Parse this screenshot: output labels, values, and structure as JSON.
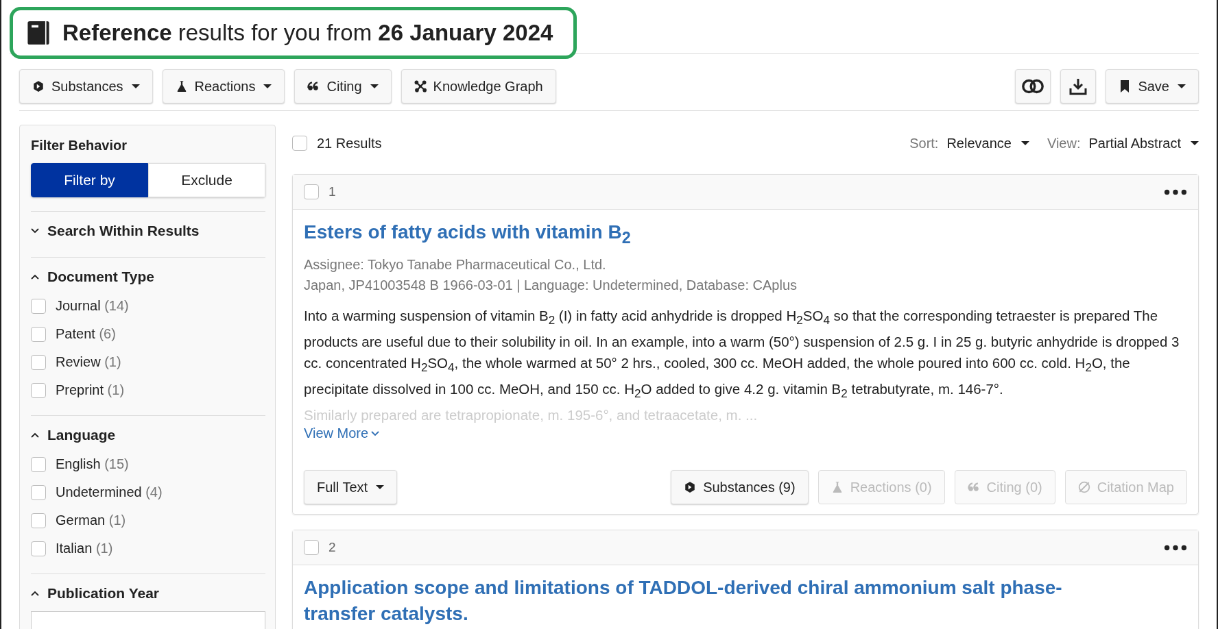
{
  "header": {
    "title": "**Reference** results for you from **26 January 2024**"
  },
  "toolbar": {
    "buttons": [
      {
        "kind": "substances",
        "label": "Substances",
        "dropdown": true
      },
      {
        "kind": "reactions",
        "label": "Reactions",
        "dropdown": true
      },
      {
        "kind": "citing",
        "label": "Citing",
        "dropdown": true
      },
      {
        "kind": "graph",
        "label": "Knowledge Graph",
        "dropdown": false
      }
    ],
    "save_label": "Save"
  },
  "sidebar": {
    "behavior_title": "Filter Behavior",
    "behavior_options": [
      {
        "label": "Filter by",
        "selected": true
      },
      {
        "label": "Exclude",
        "selected": false
      }
    ],
    "sections": [
      {
        "title": "Search Within Results",
        "expanded": false
      },
      {
        "title": "Document Type",
        "expanded": true,
        "items": [
          {
            "label": "Journal",
            "count": "(14)",
            "checked": false
          },
          {
            "label": "Patent",
            "count": "(6)",
            "checked": false
          },
          {
            "label": "Review",
            "count": "(1)",
            "checked": false
          },
          {
            "label": "Preprint",
            "count": "(1)",
            "checked": false
          }
        ]
      },
      {
        "title": "Language",
        "expanded": true,
        "items": [
          {
            "label": "English",
            "count": "(15)",
            "checked": false
          },
          {
            "label": "Undetermined",
            "count": "(4)",
            "checked": false
          },
          {
            "label": "German",
            "count": "(1)",
            "checked": false
          },
          {
            "label": "Italian",
            "count": "(1)",
            "checked": false
          }
        ]
      },
      {
        "title": "Publication Year",
        "expanded": true,
        "kind": "year"
      }
    ]
  },
  "results_bar": {
    "count": "21 Results",
    "checked": false,
    "sort_label": "Sort:",
    "sort_value": "Relevance",
    "view_label": "View:",
    "view_value": "Partial Abstract"
  },
  "results": [
    {
      "number": "1",
      "checked": false,
      "title": "Esters of fatty acids with vitamin B$_{2}$",
      "meta": [
        "Assignee: Tokyo Tanabe Pharmaceutical Co., Ltd.",
        "Japan, JP41003548 B 1966-03-01 | Language: Undetermined, Database: CAplus"
      ],
      "abstract": "Into a warming suspension of vitamin B$_{2}$ (I) in fatty acid anhydride is dropped H$_{2}$SO$_{4}$ so that the corresponding tetraester is prepared The products are useful due to their solubility in oil. In an example, into a warm (50°) suspension of 2.5 g. I in 25 g. butyric anhydride is dropped 3 cc. concentrated H$_{2}$SO$_{4}$, the whole warmed at 50° 2 hrs., cooled, 300 cc. MeOH added, the whole poured into 600 cc. cold. H$_{2}$O, the precipitate dissolved in 100 cc. MeOH, and 150 cc. H$_{2}$O added to give 4.2 g. vitamin B$_{2}$ tetrabutyrate, m. 146-7°.",
      "abstract_faded": "Similarly prepared are tetrapropionate, m. 195-6°, and tetraacetate, m. ...",
      "view_more": "View More",
      "full_text": "Full Text",
      "actions": [
        {
          "kind": "substances",
          "label": "Substances (9)",
          "disabled": false
        },
        {
          "kind": "reactions",
          "label": "Reactions (0)",
          "disabled": true
        },
        {
          "kind": "citing",
          "label": "Citing (0)",
          "disabled": true
        },
        {
          "kind": "map",
          "label": "Citation Map",
          "disabled": true
        }
      ]
    },
    {
      "number": "2",
      "checked": false,
      "title": "Application scope and limitations of TADDOL-derived chiral ammonium salt phase-transfer catalysts."
    }
  ]
}
